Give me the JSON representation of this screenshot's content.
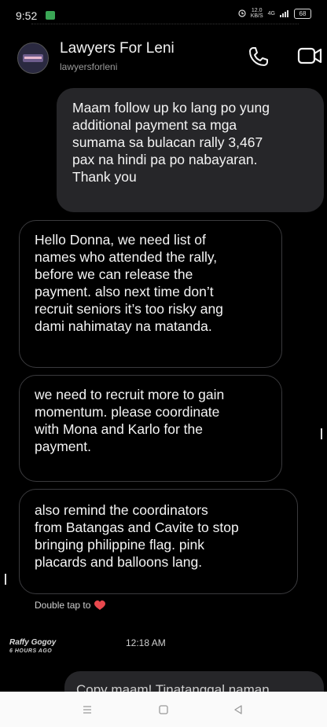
{
  "status_bar": {
    "time": "9:52",
    "network_speed": "12.0\nKB/S",
    "signal": "4G",
    "battery": "68"
  },
  "header": {
    "contact_name": "Lawyers For Leni",
    "contact_handle": "lawyersforleni",
    "call_icon": "phone-icon",
    "video_icon": "video-camera-icon"
  },
  "messages": [
    {
      "direction": "outgoing",
      "text": "Maam follow up ko lang po yung\nadditional payment sa mga\nsumama sa bulacan rally 3,467\npax na hindi pa po nabayaran.\nThank you"
    },
    {
      "direction": "incoming",
      "text": "Hello Donna, we need list of\nnames who attended the rally,\nbefore we can release the\npayment. also next time don’t\nrecruit seniors it’s too risky ang\ndami nahimatay na matanda."
    },
    {
      "direction": "incoming",
      "text": "we need to recruit more to gain\nmomentum. please coordinate\nwith Mona and Karlo for the\npayment."
    },
    {
      "direction": "incoming",
      "text": "also remind the coordinators\nfrom Batangas and Cavite to stop\nbringing philippine flag. pink\nplacards and balloons lang."
    }
  ],
  "reaction_hint": "Double tap to",
  "reaction_icon": "heart-icon",
  "overlay": {
    "sender_name": "Raffy Gogoy",
    "sender_ago": "6 HOURS AGO"
  },
  "timestamp": "12:18 AM",
  "next_message_partial": "Copy maam! Tinatanggal naman",
  "nav_bar": {
    "menu_icon": "menu-icon",
    "home_icon": "home-square-icon",
    "back_icon": "back-triangle-icon"
  },
  "colors": {
    "background": "#000000",
    "outgoing_bubble": "#262629",
    "incoming_border": "#3a3a3d",
    "heart": "#e8484d"
  }
}
